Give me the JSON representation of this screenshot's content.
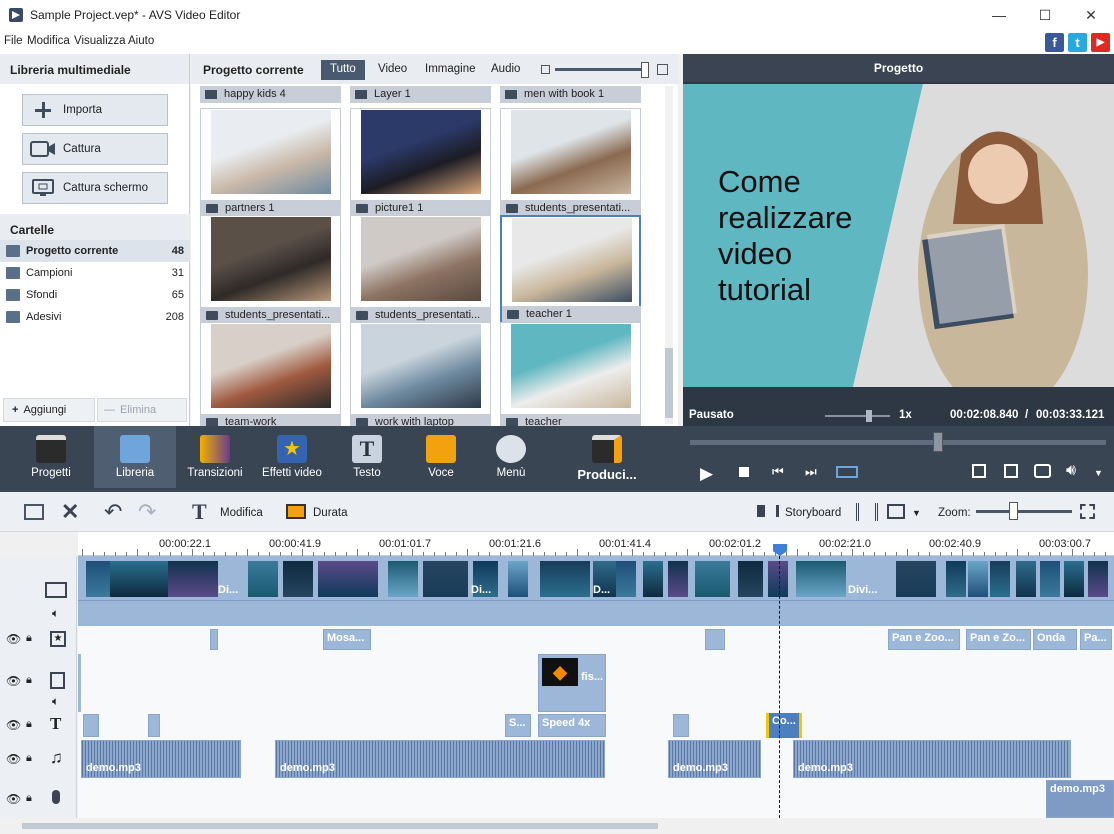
{
  "window": {
    "title": "Sample Project.vep* - AVS Video Editor",
    "minimize": "—",
    "maximize": "☐",
    "close": "✕"
  },
  "menu": {
    "file": "File",
    "edit": "Modifica",
    "view": "Visualizza",
    "help": "Aiuto"
  },
  "social": {
    "facebook": "f",
    "twitter": "t",
    "youtube": "▶"
  },
  "library": {
    "title": "Libreria multimediale",
    "buttons": {
      "import": "Importa",
      "capture": "Cattura",
      "screen_capture": "Cattura schermo"
    },
    "folders_title": "Cartelle",
    "folders": [
      {
        "name": "Progetto corrente",
        "count": "48"
      },
      {
        "name": "Campioni",
        "count": "31"
      },
      {
        "name": "Sfondi",
        "count": "65"
      },
      {
        "name": "Adesivi",
        "count": "208"
      }
    ],
    "add": "Aggiungi",
    "remove": "Elimina"
  },
  "media": {
    "title": "Progetto corrente",
    "tabs": [
      "Tutto",
      "Video",
      "Immagine",
      "Audio"
    ],
    "top_labels": [
      "happy kids 4",
      "Layer 1",
      "men with book 1"
    ],
    "items": [
      {
        "label": "partners 1",
        "colors": [
          "#e9edf1",
          "#c9b8a8",
          "#6e8aa0"
        ]
      },
      {
        "label": "picture1 1",
        "colors": [
          "#2c3a6a",
          "#1c1c24",
          "#d8a67a"
        ]
      },
      {
        "label": "students_presentati...",
        "colors": [
          "#dfe4e8",
          "#8a6a50",
          "#c8b4a0"
        ]
      },
      {
        "label": "students_presentati...",
        "colors": [
          "#5b5048",
          "#2e2a28",
          "#b89878"
        ]
      },
      {
        "label": "students_presentati...",
        "colors": [
          "#cfcac6",
          "#8d7362",
          "#5a4a40"
        ]
      },
      {
        "label": "teacher 1",
        "colors": [
          "#e8e8e8",
          "#c9b79c",
          "#3c4d62"
        ]
      },
      {
        "label": "team-work",
        "colors": [
          "#d8cfc8",
          "#a05a40",
          "#2a2a2a"
        ]
      },
      {
        "label": "work with laptop",
        "colors": [
          "#c9d4dc",
          "#6e8aa0",
          "#2e3a48"
        ]
      },
      {
        "label": "teacher",
        "colors": [
          "#5fb7c1",
          "#ededed",
          "#c9b79c"
        ]
      }
    ]
  },
  "preview": {
    "title": "Progetto",
    "video_text": [
      "Come",
      "realizzare",
      "video",
      "tutorial"
    ],
    "status": "Pausato",
    "speed": "1x",
    "current_time": "00:02:08.840",
    "total_time": "00:03:33.121",
    "position": 0.6
  },
  "tools": [
    "Progetti",
    "Libreria",
    "Transizioni",
    "Effetti video",
    "Testo",
    "Voce",
    "Menù",
    "Produci..."
  ],
  "edit_toolbar": {
    "edit": "Modifica",
    "duration": "Durata",
    "storyboard": "Storyboard",
    "zoom": "Zoom:"
  },
  "ruler": [
    "00:00:22.1",
    "00:00:41.9",
    "00:01:01.7",
    "00:01:21.6",
    "00:01:41.4",
    "00:02:01.2",
    "00:02:21.0",
    "00:02:40.9",
    "00:03:00.7"
  ],
  "timeline": {
    "video_clip_labels": [
      "Di...",
      "Di...",
      "D...",
      "Divi..."
    ],
    "effect_clips": [
      "Mosa...",
      "Pan e Zoo...",
      "Pan e Zo...",
      "Onda",
      "Pa..."
    ],
    "overlay_clip": "fis...",
    "text_clips": [
      "S...",
      "Speed 4x",
      "Co..."
    ],
    "audio_label": "demo.mp3"
  },
  "colors": {
    "accent": "#4c7fc0",
    "dark": "#3a4554",
    "teal": "#5fb7c1"
  }
}
